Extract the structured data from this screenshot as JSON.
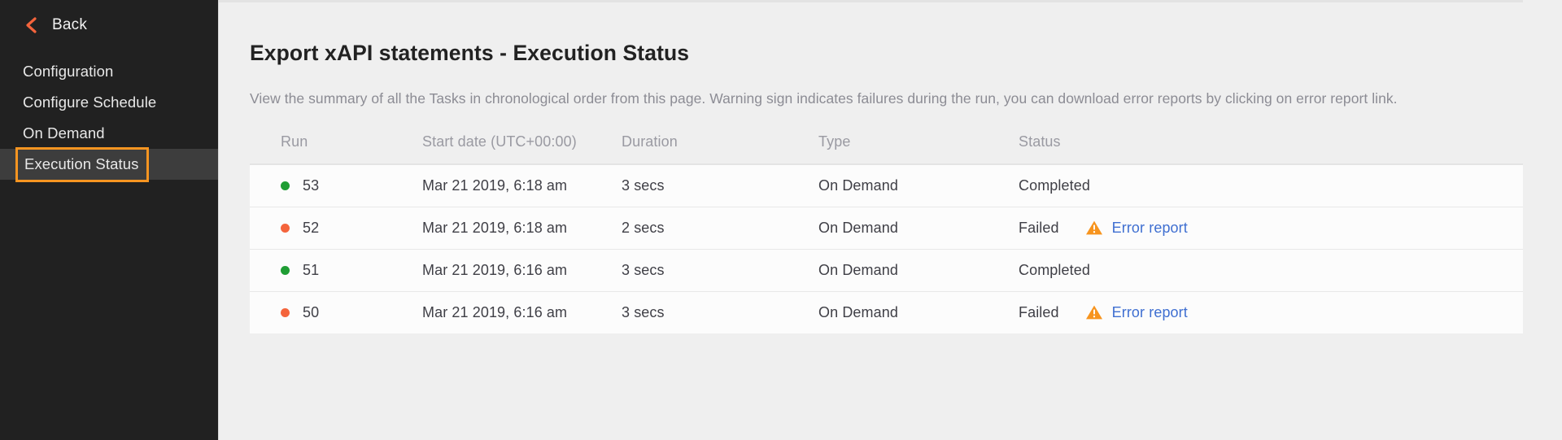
{
  "sidebar": {
    "back": {
      "label": "Back",
      "icon": "chevron-left-icon",
      "color": "#f4643c"
    },
    "items": [
      {
        "label": "Configuration",
        "selected": false
      },
      {
        "label": "Configure Schedule",
        "selected": false
      },
      {
        "label": "On Demand",
        "selected": false
      },
      {
        "label": "Execution Status",
        "selected": true
      }
    ],
    "background": "#212121",
    "selected_background": "#3d3d3d",
    "focus_outline_color": "#f79521"
  },
  "main": {
    "title": "Export xAPI statements - Execution Status",
    "description": "View the summary of all the Tasks in chronological order from this page. Warning sign indicates failures during the run, you can download error reports by clicking on error report link.",
    "table": {
      "columns": [
        "Run",
        "Start date (UTC+00:00)",
        "Duration",
        "Type",
        "Status"
      ],
      "rows": [
        {
          "status_dot": "success",
          "run": "53",
          "start_date": "Mar 21 2019, 6:18 am",
          "duration": "3 secs",
          "type": "On Demand",
          "status": "Completed",
          "error_report": null
        },
        {
          "status_dot": "failed",
          "run": "52",
          "start_date": "Mar 21 2019, 6:18 am",
          "duration": "2 secs",
          "type": "On Demand",
          "status": "Failed",
          "error_report": "Error report"
        },
        {
          "status_dot": "success",
          "run": "51",
          "start_date": "Mar 21 2019, 6:16 am",
          "duration": "3 secs",
          "type": "On Demand",
          "status": "Completed",
          "error_report": null
        },
        {
          "status_dot": "failed",
          "run": "50",
          "start_date": "Mar 21 2019, 6:16 am",
          "duration": "3 secs",
          "type": "On Demand",
          "status": "Failed",
          "error_report": "Error report"
        }
      ]
    }
  },
  "colors": {
    "success_dot": "#1f9d34",
    "failed_dot": "#f4643c",
    "warning_icon": "#f7941e",
    "link": "#3f6fd1",
    "content_background": "#efefef",
    "table_background": "#fcfcfc"
  }
}
